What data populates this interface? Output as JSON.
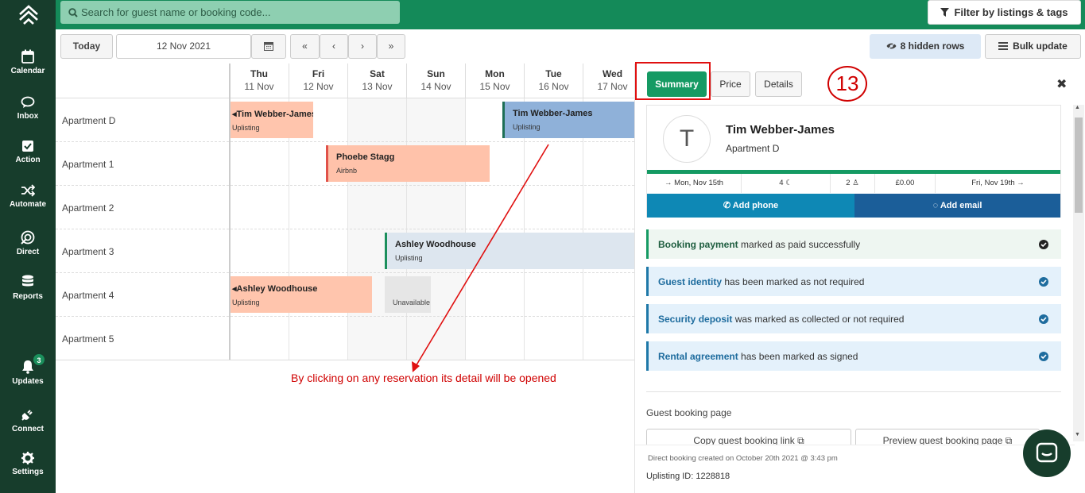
{
  "sidebar": {
    "items": [
      {
        "label": "Calendar",
        "icon": "calendar-icon"
      },
      {
        "label": "Inbox",
        "icon": "chat-icon"
      },
      {
        "label": "Action",
        "icon": "checkbox-icon"
      },
      {
        "label": "Automate",
        "icon": "shuffle-icon"
      },
      {
        "label": "Direct",
        "icon": "direct-icon"
      },
      {
        "label": "Reports",
        "icon": "database-icon"
      },
      {
        "label": "Updates",
        "icon": "bell-icon",
        "badge": "3"
      },
      {
        "label": "Connect",
        "icon": "plug-icon"
      },
      {
        "label": "Settings",
        "icon": "gear-icon"
      }
    ]
  },
  "topbar": {
    "search_placeholder": "Search for guest name or booking code...",
    "filter_label": "Filter by listings & tags"
  },
  "toolbar": {
    "today_label": "Today",
    "date_value": "12 Nov 2021",
    "nav_first": "«",
    "nav_prev": "‹",
    "nav_next": "›",
    "nav_last": "»",
    "hidden_rows_label": "8 hidden rows",
    "bulk_update_label": "Bulk update"
  },
  "calendar": {
    "days": [
      {
        "name": "Thu",
        "date": "11 Nov"
      },
      {
        "name": "Fri",
        "date": "12 Nov"
      },
      {
        "name": "Sat",
        "date": "13 Nov"
      },
      {
        "name": "Sun",
        "date": "14 Nov"
      },
      {
        "name": "Mon",
        "date": "15 Nov"
      },
      {
        "name": "Tue",
        "date": "16 Nov"
      },
      {
        "name": "Wed",
        "date": "17 Nov"
      }
    ],
    "listings": [
      "Apartment D",
      "Apartment 1",
      "Apartment 2",
      "Apartment 3",
      "Apartment 4",
      "Apartment 5"
    ],
    "reservations": [
      {
        "guest": "Tim Webber-James",
        "channel": "Uplisting"
      },
      {
        "guest": "Tim Webber-James",
        "channel": "Uplisting"
      },
      {
        "guest": "Phoebe Stagg",
        "channel": "Airbnb"
      },
      {
        "guest": "Ashley Woodhouse",
        "channel": "Uplisting"
      },
      {
        "guest": "Ashley Woodhouse",
        "channel": "Uplisting"
      }
    ],
    "unavailable_label": "Unavailable"
  },
  "annotation": {
    "step_number": "13",
    "note": "By clicking on any reservation its detail will be opened"
  },
  "panel": {
    "tabs": {
      "summary": "Summary",
      "price": "Price",
      "details": "Details"
    },
    "close_symbol": "✖",
    "avatar_initial": "T",
    "guest_name": "Tim Webber-James",
    "listing": "Apartment D",
    "checkin": "→ Mon, Nov 15th",
    "nights": "4",
    "guests": "2",
    "total": "£0.00",
    "checkout": "Fri, Nov 19th →",
    "add_phone": "Add phone",
    "add_email": "Add email",
    "checklist": [
      {
        "bold": "Booking payment",
        "rest": " marked as paid successfully"
      },
      {
        "bold": "Guest identity",
        "rest": " has been marked as not required"
      },
      {
        "bold": "Security deposit",
        "rest": " was marked as collected or not required"
      },
      {
        "bold": "Rental agreement",
        "rest": " has been marked as signed"
      }
    ],
    "guest_page_title": "Guest booking page",
    "copy_link": "Copy guest booking link",
    "preview_page": "Preview guest booking page",
    "created_note": "Direct booking created on October 20th 2021 @ 3:43 pm",
    "uplisting_id": "Uplisting ID: 1228818"
  },
  "colors": {
    "sidebar": "#173d2c",
    "topbar": "#148a59",
    "accent": "#1b8f5c",
    "reservation_uplisting": "#ffc5ad",
    "reservation_selected": "#8fb1d9",
    "reservation_airbnb": "#ffc2aa",
    "annotation_red": "#d00000"
  }
}
